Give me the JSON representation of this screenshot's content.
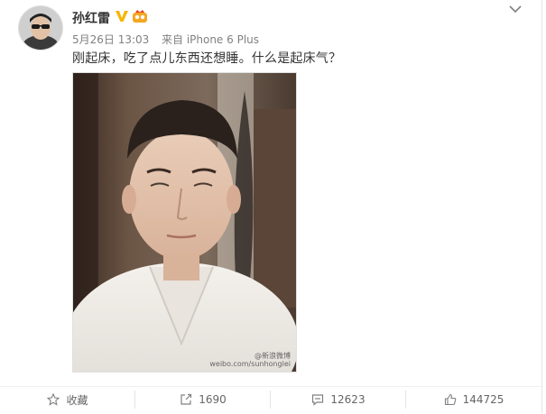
{
  "post": {
    "author": "孙红雷",
    "date": "5月26日 13:03",
    "source_prefix": "来自",
    "source": "iPhone 6 Plus",
    "text": "刚起床，吃了点儿东西还想睡。什么是起床气？"
  },
  "photo": {
    "watermark_line1": "@新浪微博",
    "watermark_line2": "weibo.com/sunhonglei"
  },
  "actions": {
    "favorite_label": "收藏",
    "repost_count": "1690",
    "comment_count": "12623",
    "like_count": "144725"
  },
  "colors": {
    "verified": "#f7b500",
    "member": "#f5a623",
    "text": "#333333",
    "meta": "#808080"
  },
  "icons": {
    "verified": "verified-v-icon",
    "member": "vip-crown-icon",
    "more": "chevron-down-icon",
    "favorite": "star-icon",
    "repost": "share-box-icon",
    "comment": "comment-icon",
    "like": "thumbs-up-icon"
  }
}
